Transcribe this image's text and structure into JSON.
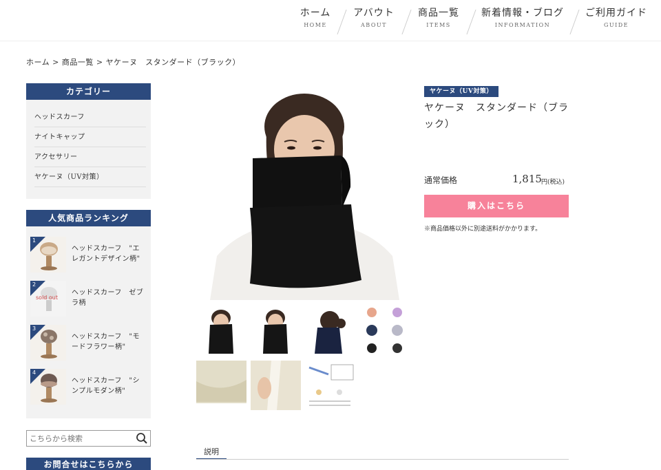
{
  "nav": [
    {
      "jp": "ホーム",
      "en": "HOME"
    },
    {
      "jp": "アバウト",
      "en": "ABOUT"
    },
    {
      "jp": "商品一覧",
      "en": "ITEMS"
    },
    {
      "jp": "新着情報・ブログ",
      "en": "INFORMATION"
    },
    {
      "jp": "ご利用ガイド",
      "en": "GUIDE"
    }
  ],
  "breadcrumb": "ホーム > 商品一覧 > ヤケーヌ　スタンダード（ブラック）",
  "sidebar": {
    "category_title": "カテゴリー",
    "categories": [
      "ヘッドスカーフ",
      "ナイトキャップ",
      "アクセサリー",
      "ヤケーヌ（UV対策）"
    ],
    "ranking_title": "人気商品ランキング",
    "ranking": [
      {
        "num": "1",
        "name": "ヘッドスカーフ　\"エレガントデザイン柄\""
      },
      {
        "num": "2",
        "name": "ヘッドスカーフ　ゼブラ柄",
        "badge": "sold out"
      },
      {
        "num": "3",
        "name": "ヘッドスカーフ　\"モードフラワー柄\""
      },
      {
        "num": "4",
        "name": "ヘッドスカーフ　\"シンプルモダン柄\""
      }
    ],
    "search_placeholder": "こちらから検索",
    "contact_title": "お問合せはこちらから"
  },
  "product": {
    "category": "ヤケーヌ（UV対策）",
    "title": "ヤケーヌ　スタンダード（ブラック）",
    "price_label": "通常価格",
    "price": "1,815",
    "price_unit": "円(税込)",
    "buy_label": "購入はこちら",
    "note": "※商品価格以外に別途送料がかかります。"
  },
  "tabs": [
    "説明"
  ],
  "colors": {
    "navy": "#2c4a7e",
    "pink": "#f7829a",
    "sidebar_bg": "#f2f2f2"
  }
}
